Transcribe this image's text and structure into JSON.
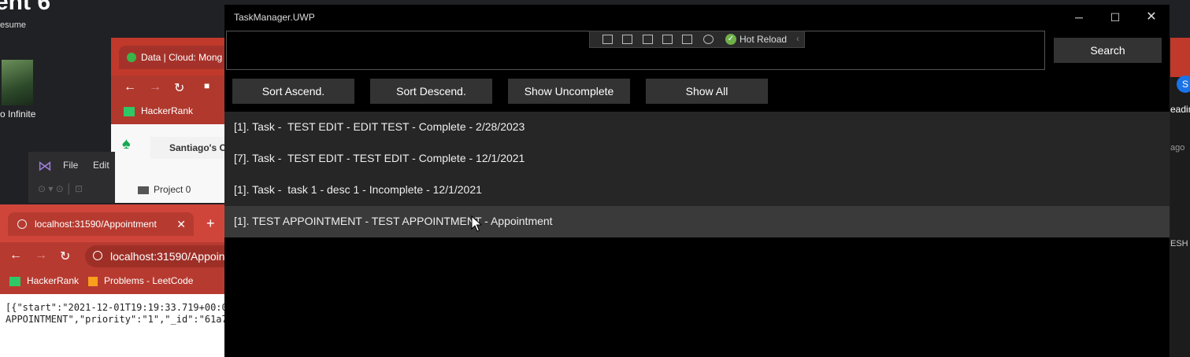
{
  "desktop": {
    "title_fragment": "ent 6",
    "resume": "esume",
    "icon_label": "o Infinite"
  },
  "browser1": {
    "tab_title": "Data | Cloud: Mong",
    "bookmark": "HackerRank",
    "org": "Santiago's C",
    "project": "Project 0"
  },
  "vs": {
    "file": "File",
    "edit": "Edit"
  },
  "browser2": {
    "tab_title": "localhost:31590/Appointment",
    "url": "localhost:31590/Appoin",
    "bookmarks": [
      "HackerRank",
      "Problems - LeetCode"
    ],
    "json_text": "[{\"start\":\"2021-12-01T19:19:33.719+00:0\nAPPOINTMENT\",\"priority\":\"1\",\"_id\":\"61a7"
  },
  "right_strip": {
    "avatar": "S",
    "text1": "eadin",
    "text2": "ago",
    "text3": "ESH"
  },
  "window": {
    "title": "TaskManager.UWP",
    "hot_reload": "Hot Reload",
    "search_button": "Search",
    "sort_buttons": [
      "Sort Ascend.",
      "Sort Descend.",
      "Show Uncomplete",
      "Show All"
    ]
  },
  "tasks": [
    "[1]. Task -  TEST EDIT - EDIT TEST - Complete - 2/28/2023",
    "[7]. Task -  TEST EDIT - TEST EDIT - Complete - 12/1/2021",
    "[1]. Task -  task 1 - desc 1 - Incomplete - 12/1/2021",
    "[1]. TEST APPOINTMENT - TEST APPOINTMENT - Appointment"
  ],
  "colors": {
    "window_bg": "#000000",
    "button_bg": "#333333",
    "row_bg": "#262626",
    "row_hover_bg": "#3a3a3a",
    "hot_reload_check": "#6fb04a"
  }
}
